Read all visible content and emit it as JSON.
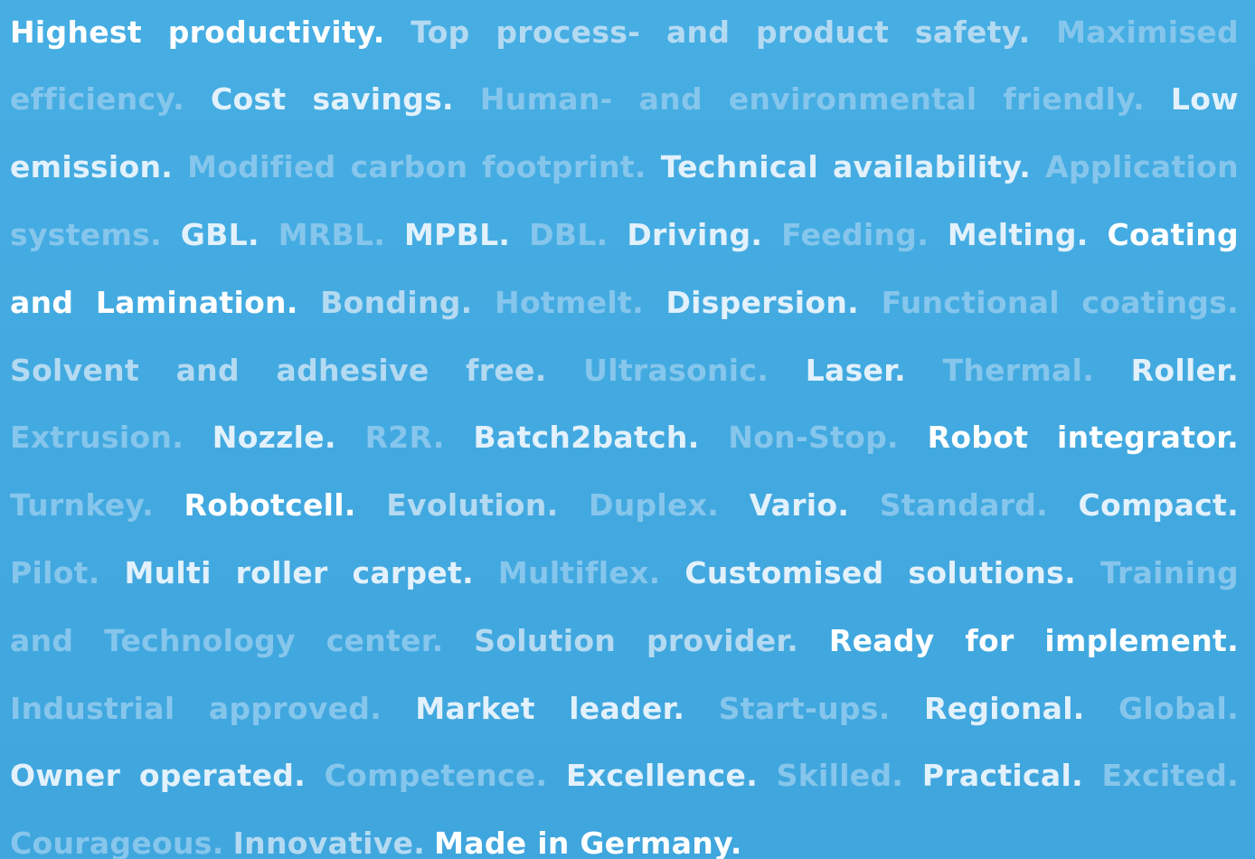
{
  "colors": {
    "background": "#44abe1",
    "white": "#ffffff",
    "dark": "#e2f1fb",
    "mid": "#b4daf2",
    "light": "#86c6ec"
  },
  "lines": [
    [
      {
        "text": "Highest",
        "tone": "white"
      },
      {
        "text": "productivity.",
        "tone": "white"
      },
      {
        "text": "Top",
        "tone": "mid"
      },
      {
        "text": "process-",
        "tone": "mid"
      },
      {
        "text": "and",
        "tone": "mid"
      },
      {
        "text": "product",
        "tone": "mid"
      },
      {
        "text": "safety.",
        "tone": "mid"
      },
      {
        "text": "Maximised",
        "tone": "light"
      }
    ],
    [
      {
        "text": "efficiency.",
        "tone": "light"
      },
      {
        "text": "Cost",
        "tone": "dark"
      },
      {
        "text": "savings.",
        "tone": "dark"
      },
      {
        "text": "Human-",
        "tone": "light"
      },
      {
        "text": "and",
        "tone": "light"
      },
      {
        "text": "environmental",
        "tone": "light"
      },
      {
        "text": "friendly.",
        "tone": "light"
      },
      {
        "text": "Low",
        "tone": "dark"
      }
    ],
    [
      {
        "text": "emission.",
        "tone": "dark"
      },
      {
        "text": "Modified",
        "tone": "light"
      },
      {
        "text": "carbon",
        "tone": "light"
      },
      {
        "text": "footprint.",
        "tone": "light"
      },
      {
        "text": "Technical",
        "tone": "dark"
      },
      {
        "text": "availability.",
        "tone": "dark"
      },
      {
        "text": "Application",
        "tone": "light"
      }
    ],
    [
      {
        "text": "systems.",
        "tone": "light"
      },
      {
        "text": "GBL.",
        "tone": "dark"
      },
      {
        "text": "MRBL.",
        "tone": "light"
      },
      {
        "text": "MPBL.",
        "tone": "dark"
      },
      {
        "text": "DBL.",
        "tone": "light"
      },
      {
        "text": "Driving.",
        "tone": "dark"
      },
      {
        "text": "Feeding.",
        "tone": "light"
      },
      {
        "text": "Melting.",
        "tone": "dark"
      },
      {
        "text": "Coating",
        "tone": "white"
      }
    ],
    [
      {
        "text": "and",
        "tone": "white"
      },
      {
        "text": "Lamination.",
        "tone": "white"
      },
      {
        "text": "Bonding.",
        "tone": "mid"
      },
      {
        "text": "Hotmelt.",
        "tone": "light"
      },
      {
        "text": "Dispersion.",
        "tone": "dark"
      },
      {
        "text": "Functional",
        "tone": "light"
      },
      {
        "text": "coatings.",
        "tone": "light"
      }
    ],
    [
      {
        "text": "Solvent",
        "tone": "mid"
      },
      {
        "text": "and",
        "tone": "mid"
      },
      {
        "text": "adhesive",
        "tone": "mid"
      },
      {
        "text": "free.",
        "tone": "mid"
      },
      {
        "text": "Ultrasonic.",
        "tone": "light"
      },
      {
        "text": "Laser.",
        "tone": "dark"
      },
      {
        "text": "Thermal.",
        "tone": "light"
      },
      {
        "text": "Roller.",
        "tone": "dark"
      }
    ],
    [
      {
        "text": "Extrusion.",
        "tone": "light"
      },
      {
        "text": "Nozzle.",
        "tone": "dark"
      },
      {
        "text": "R2R.",
        "tone": "light"
      },
      {
        "text": "Batch2batch.",
        "tone": "dark"
      },
      {
        "text": "Non-Stop.",
        "tone": "light"
      },
      {
        "text": "Robot",
        "tone": "white"
      },
      {
        "text": "integrator.",
        "tone": "white"
      }
    ],
    [
      {
        "text": "Turnkey.",
        "tone": "light"
      },
      {
        "text": "Robotcell.",
        "tone": "white"
      },
      {
        "text": "Evolution.",
        "tone": "mid"
      },
      {
        "text": "Duplex.",
        "tone": "light"
      },
      {
        "text": "Vario.",
        "tone": "dark"
      },
      {
        "text": "Standard.",
        "tone": "light"
      },
      {
        "text": "Compact.",
        "tone": "dark"
      }
    ],
    [
      {
        "text": "Pilot.",
        "tone": "light"
      },
      {
        "text": "Multi",
        "tone": "dark"
      },
      {
        "text": "roller",
        "tone": "dark"
      },
      {
        "text": "carpet.",
        "tone": "dark"
      },
      {
        "text": "Multiflex.",
        "tone": "light"
      },
      {
        "text": "Customised",
        "tone": "dark"
      },
      {
        "text": "solutions.",
        "tone": "dark"
      },
      {
        "text": "Training",
        "tone": "light"
      }
    ],
    [
      {
        "text": "and",
        "tone": "light"
      },
      {
        "text": "Technology",
        "tone": "light"
      },
      {
        "text": "center.",
        "tone": "light"
      },
      {
        "text": "Solution",
        "tone": "mid"
      },
      {
        "text": "provider.",
        "tone": "mid"
      },
      {
        "text": "Ready",
        "tone": "white"
      },
      {
        "text": "for",
        "tone": "white"
      },
      {
        "text": "implement.",
        "tone": "white"
      }
    ],
    [
      {
        "text": "Industrial",
        "tone": "light"
      },
      {
        "text": "approved.",
        "tone": "light"
      },
      {
        "text": "Market",
        "tone": "dark"
      },
      {
        "text": "leader.",
        "tone": "dark"
      },
      {
        "text": "Start-ups.",
        "tone": "light"
      },
      {
        "text": "Regional.",
        "tone": "dark"
      },
      {
        "text": "Global.",
        "tone": "light"
      }
    ],
    [
      {
        "text": "Owner",
        "tone": "dark"
      },
      {
        "text": "operated.",
        "tone": "dark"
      },
      {
        "text": "Competence.",
        "tone": "light"
      },
      {
        "text": "Excellence.",
        "tone": "dark"
      },
      {
        "text": "Skilled.",
        "tone": "light"
      },
      {
        "text": "Practical.",
        "tone": "dark"
      },
      {
        "text": "Excited.",
        "tone": "light"
      }
    ],
    [
      {
        "text": "Courageous.",
        "tone": "light"
      },
      {
        "text": "Innovative.",
        "tone": "mid"
      },
      {
        "text": "Made in Germany.",
        "tone": "white"
      }
    ]
  ]
}
